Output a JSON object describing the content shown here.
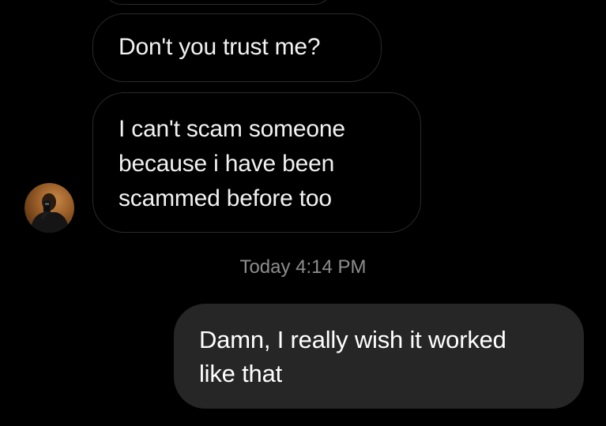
{
  "conversation": {
    "messages": [
      {
        "sender": "other",
        "lines": [
          "Don't you trust me?"
        ]
      },
      {
        "sender": "other",
        "lines": [
          "I can't scam someone",
          "because i have been",
          "scammed before too"
        ]
      },
      {
        "sender": "me",
        "lines": [
          "Damn, I really wish it worked",
          "like that"
        ]
      }
    ],
    "timestamp": "Today 4:14 PM",
    "avatar_icon": "user-avatar-photo"
  },
  "colors": {
    "background": "#000000",
    "incoming_border": "#2a2a2a",
    "outgoing_bubble": "#262626",
    "timestamp": "#8e8e8e"
  }
}
